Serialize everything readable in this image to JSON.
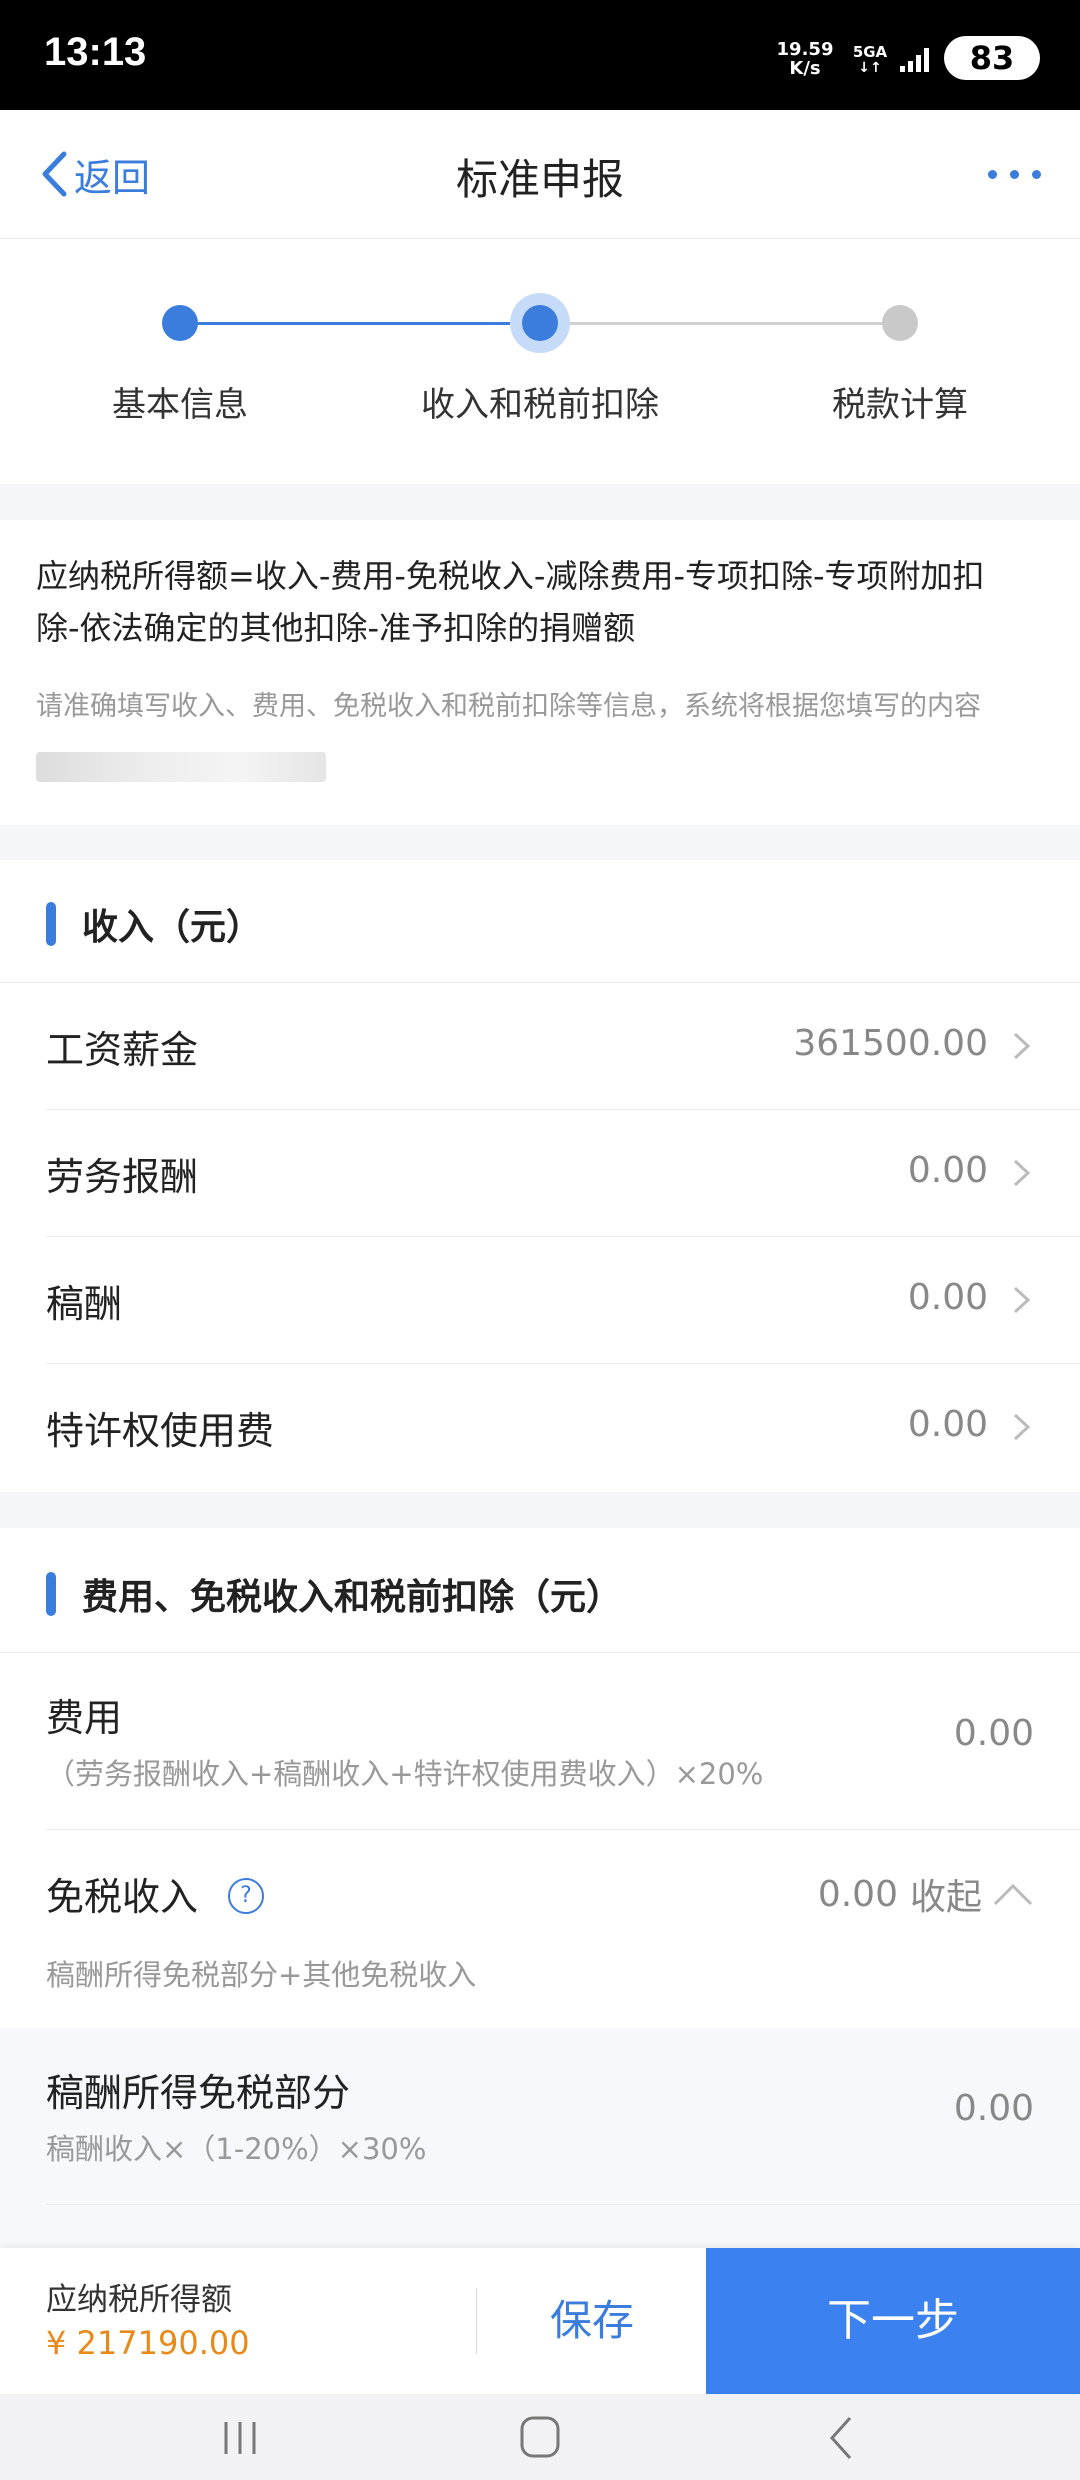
{
  "status_bar": {
    "time": "13:13",
    "net_speed_value": "19.59",
    "net_speed_unit": "K/s",
    "network": "5GA",
    "battery": "83"
  },
  "header": {
    "back_label": "返回",
    "title": "标准申报"
  },
  "steps": [
    {
      "label": "基本信息",
      "state": "done"
    },
    {
      "label": "收入和税前扣除",
      "state": "active"
    },
    {
      "label": "税款计算",
      "state": "pending"
    }
  ],
  "formula": {
    "line1": "应纳税所得额=收入-费用-免税收入-减除费用-专项扣除-专项附加扣",
    "line2": "除-依法确定的其他扣除-准予扣除的捐赠额",
    "hint": "请准确填写收入、费用、免税收入和税前扣除等信息，系统将根据您填写的内容"
  },
  "income_section": {
    "title": "收入（元）",
    "rows": [
      {
        "label": "工资薪金",
        "value": "361500.00"
      },
      {
        "label": "劳务报酬",
        "value": "0.00"
      },
      {
        "label": "稿酬",
        "value": "0.00"
      },
      {
        "label": "特许权使用费",
        "value": "0.00"
      }
    ]
  },
  "deduction_section": {
    "title": "费用、免税收入和税前扣除（元）",
    "expense": {
      "label": "费用",
      "formula": "（劳务报酬收入+稿酬收入+特许权使用费收入）×20%",
      "value": "0.00"
    },
    "tax_free": {
      "label": "免税收入",
      "value": "0.00",
      "toggle_label": "收起",
      "desc": "稿酬所得免税部分+其他免税收入"
    },
    "royalty_free": {
      "label": "稿酬所得免税部分",
      "formula": "稿酬收入×（1-20%）×30%",
      "value": "0.00"
    }
  },
  "bottom_bar": {
    "taxable_label": "应纳税所得额",
    "taxable_value": "¥ 217190.00",
    "save_label": "保存",
    "next_label": "下一步"
  },
  "colors": {
    "accent": "#3b7ddd",
    "primary_button": "#3b82f0",
    "amount_orange": "#e88a1a"
  }
}
